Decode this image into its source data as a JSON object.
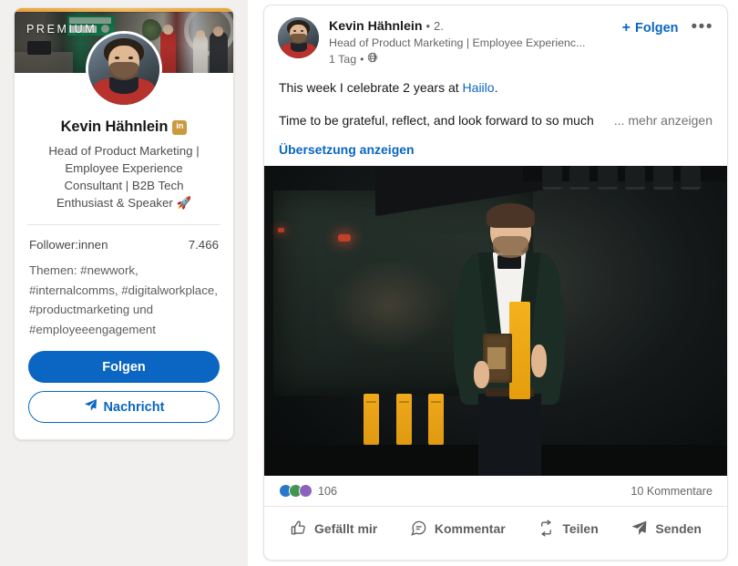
{
  "colors": {
    "linkedin_blue": "#0a66c2",
    "premium_gold": "#c99a3e",
    "page_bg": "#f1f0ee",
    "card_bg": "#ffffff",
    "text_primary": "#191919",
    "text_secondary": "#666666"
  },
  "sidebar": {
    "premium_label": "PREMIUM",
    "name": "Kevin Hähnlein",
    "badge_text": "in",
    "headline": "Head of Product Marketing | Employee Experience Consultant | B2B Tech Enthusiast & Speaker 🚀",
    "followers_label": "Follower:innen",
    "followers_count": "7.466",
    "topics": "Themen: #newwork, #internalcomms, #digitalworkplace, #productmarketing und #employeeengagement",
    "follow_button": "Folgen",
    "message_button": "Nachricht"
  },
  "post": {
    "author": "Kevin Hähnlein",
    "degree_separator": "•",
    "degree": "2.",
    "subtitle": "Head of Product Marketing | Employee Experienc...",
    "time": "1 Tag",
    "time_separator": "•",
    "visibility_icon": "globe-icon",
    "follow_button": "Folgen",
    "follow_plus": "+",
    "more_menu": "•••",
    "text_line_1_prefix": "This week I celebrate 2 years at ",
    "text_line_1_link": "Haiilo",
    "text_line_1_suffix": ".",
    "text_line_2": "Time to be grateful, reflect, and look forward to so much",
    "see_more": "... mehr anzeigen",
    "translate": "Übersetzung anzeigen",
    "media_alt": "Kevin Hähnlein on stage in a dark green velvet tuxedo holding a gold award",
    "reactions_count": "106",
    "comments_count": "10 Kommentare",
    "reaction_types": [
      "like-icon",
      "celebrate-icon",
      "support-icon"
    ],
    "actions": [
      {
        "label": "Gefällt mir",
        "icon": "thumbs-up-icon"
      },
      {
        "label": "Kommentar",
        "icon": "comment-bubble-icon"
      },
      {
        "label": "Teilen",
        "icon": "repost-icon"
      },
      {
        "label": "Senden",
        "icon": "send-icon"
      }
    ]
  }
}
